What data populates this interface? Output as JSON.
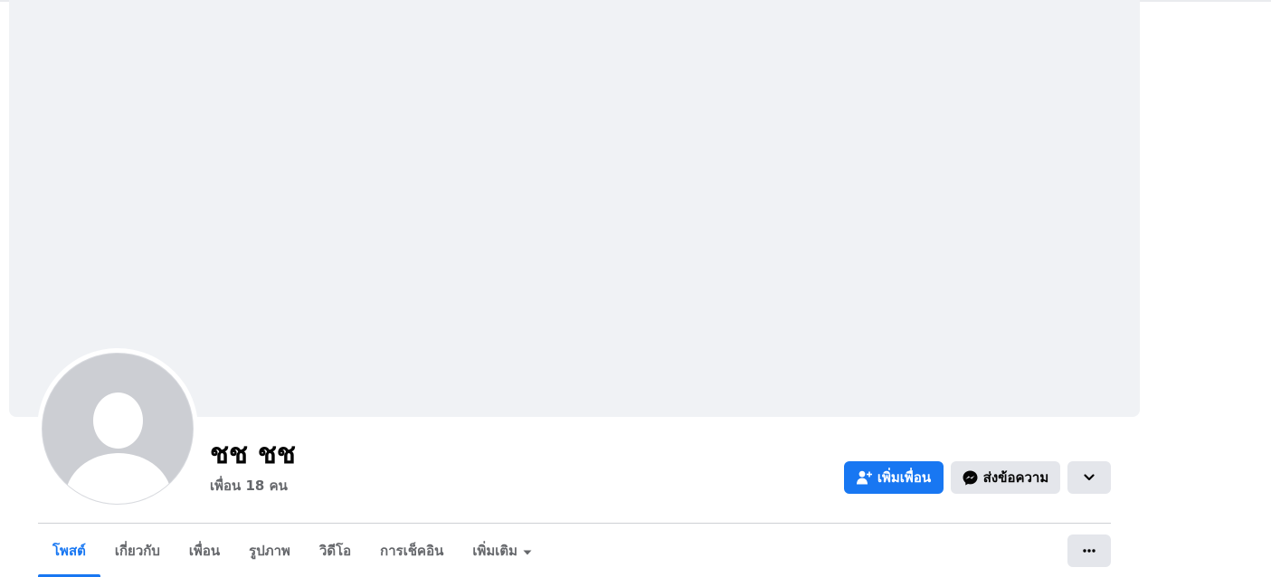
{
  "profile": {
    "name": "ชช ชช",
    "friends_count": "เพื่อน 18 คน"
  },
  "actions": {
    "add_friend_label": "เพิ่มเพื่อน",
    "message_label": "ส่งข้อความ"
  },
  "tabs": [
    {
      "label": "โพสต์",
      "active": true
    },
    {
      "label": "เกี่ยวกับ"
    },
    {
      "label": "เพื่อน"
    },
    {
      "label": "รูปภาพ"
    },
    {
      "label": "วิดีโอ"
    },
    {
      "label": "การเช็คอิน"
    },
    {
      "label": "เพิ่มเติม"
    }
  ],
  "colors": {
    "accent": "#1877f2",
    "secondary_button": "#e4e6eb",
    "cover": "#f0f2f5",
    "muted_text": "#65676b"
  },
  "icons": {
    "add_friend": "person-plus-icon",
    "message": "messenger-icon",
    "more": "chevron-down-icon",
    "tab_more": "caret-down-icon",
    "options": "ellipsis-icon"
  }
}
